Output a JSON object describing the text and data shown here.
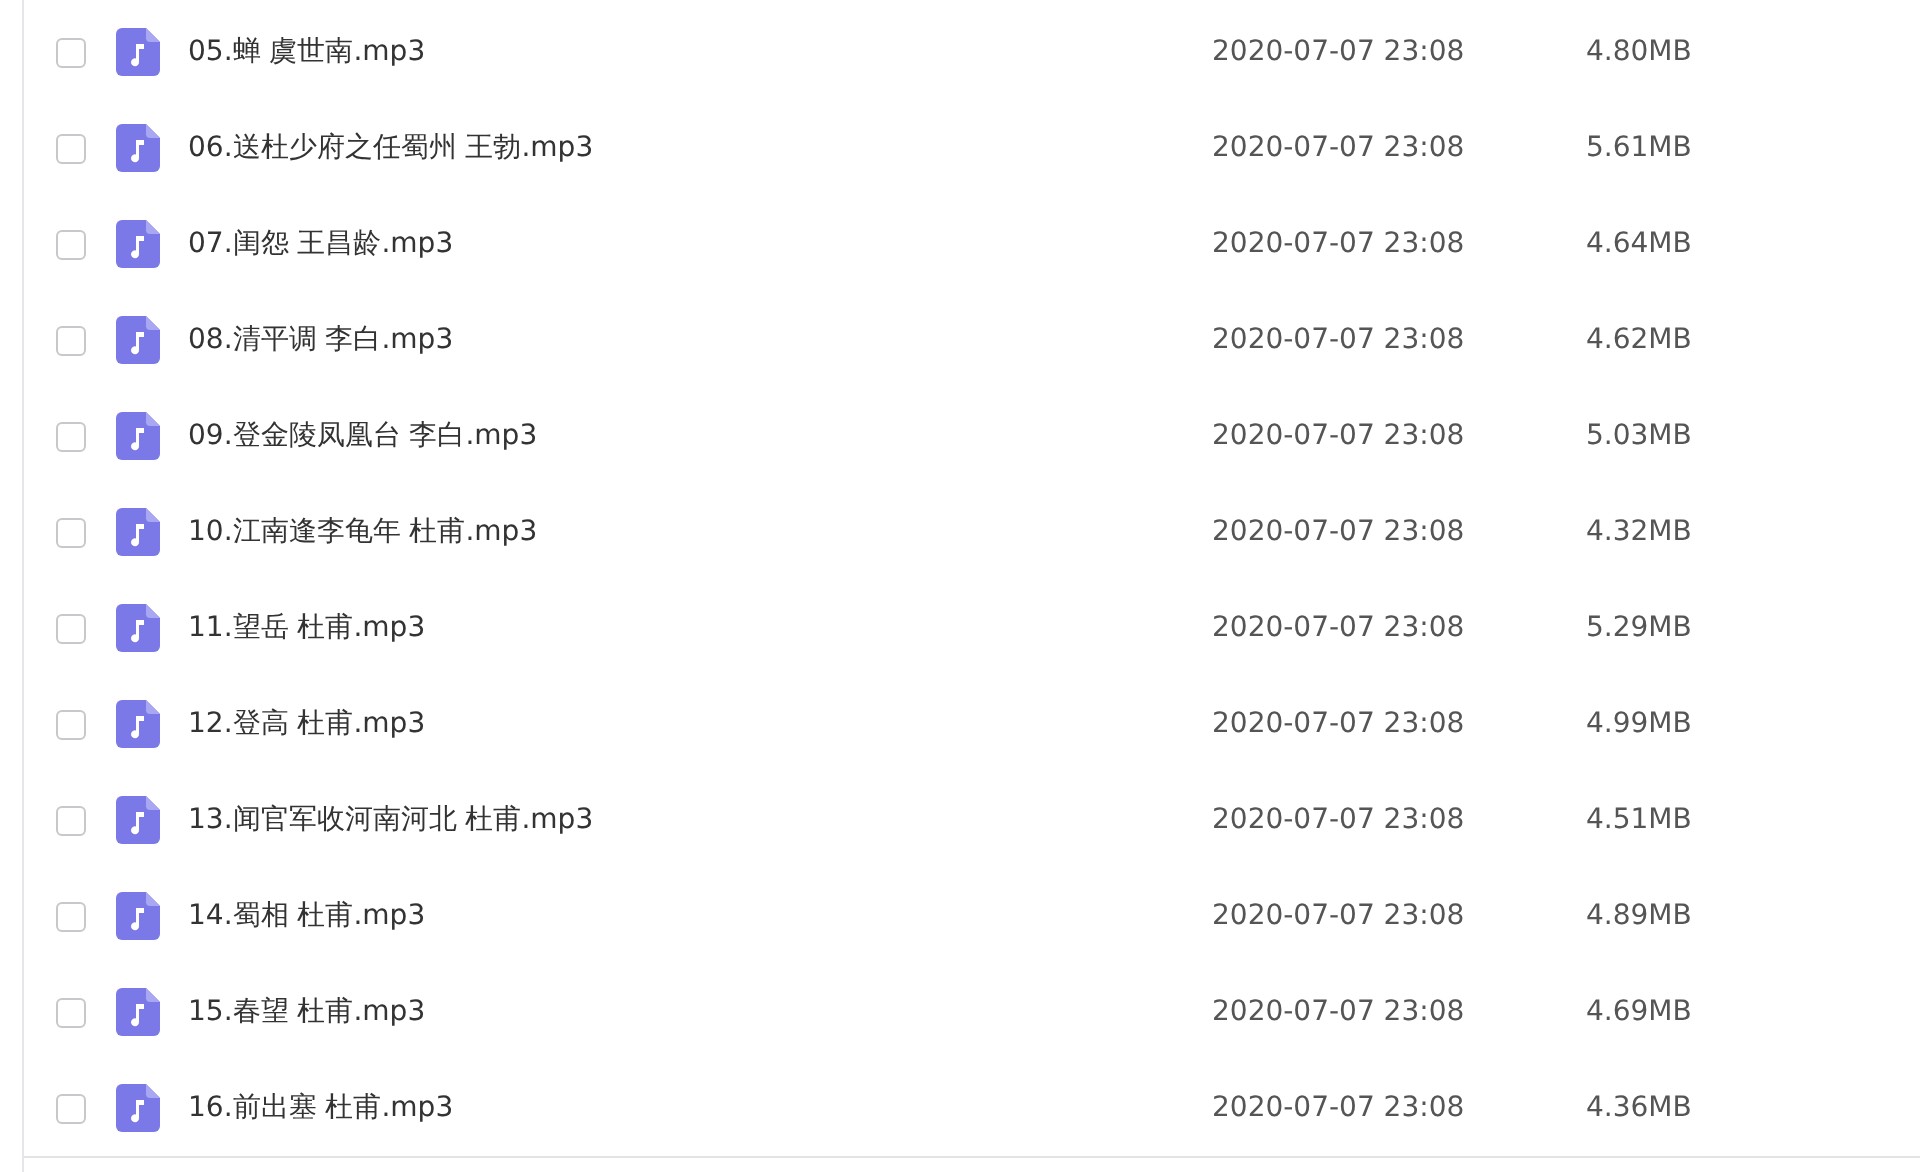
{
  "files": [
    {
      "name": "05.蝉 虞世南.mp3",
      "modified": "2020-07-07 23:08",
      "size": "4.80MB",
      "checked": false
    },
    {
      "name": "06.送杜少府之任蜀州 王勃.mp3",
      "modified": "2020-07-07 23:08",
      "size": "5.61MB",
      "checked": false
    },
    {
      "name": "07.闺怨 王昌龄.mp3",
      "modified": "2020-07-07 23:08",
      "size": "4.64MB",
      "checked": false
    },
    {
      "name": "08.清平调 李白.mp3",
      "modified": "2020-07-07 23:08",
      "size": "4.62MB",
      "checked": false
    },
    {
      "name": "09.登金陵凤凰台 李白.mp3",
      "modified": "2020-07-07 23:08",
      "size": "5.03MB",
      "checked": false
    },
    {
      "name": "10.江南逢李龟年 杜甫.mp3",
      "modified": "2020-07-07 23:08",
      "size": "4.32MB",
      "checked": false
    },
    {
      "name": "11.望岳 杜甫.mp3",
      "modified": "2020-07-07 23:08",
      "size": "5.29MB",
      "checked": false
    },
    {
      "name": "12.登高 杜甫.mp3",
      "modified": "2020-07-07 23:08",
      "size": "4.99MB",
      "checked": false
    },
    {
      "name": "13.闻官军收河南河北 杜甫.mp3",
      "modified": "2020-07-07 23:08",
      "size": "4.51MB",
      "checked": false
    },
    {
      "name": "14.蜀相 杜甫.mp3",
      "modified": "2020-07-07 23:08",
      "size": "4.89MB",
      "checked": false
    },
    {
      "name": "15.春望 杜甫.mp3",
      "modified": "2020-07-07 23:08",
      "size": "4.69MB",
      "checked": false
    },
    {
      "name": "16.前出塞 杜甫.mp3",
      "modified": "2020-07-07 23:08",
      "size": "4.36MB",
      "checked": false
    }
  ]
}
